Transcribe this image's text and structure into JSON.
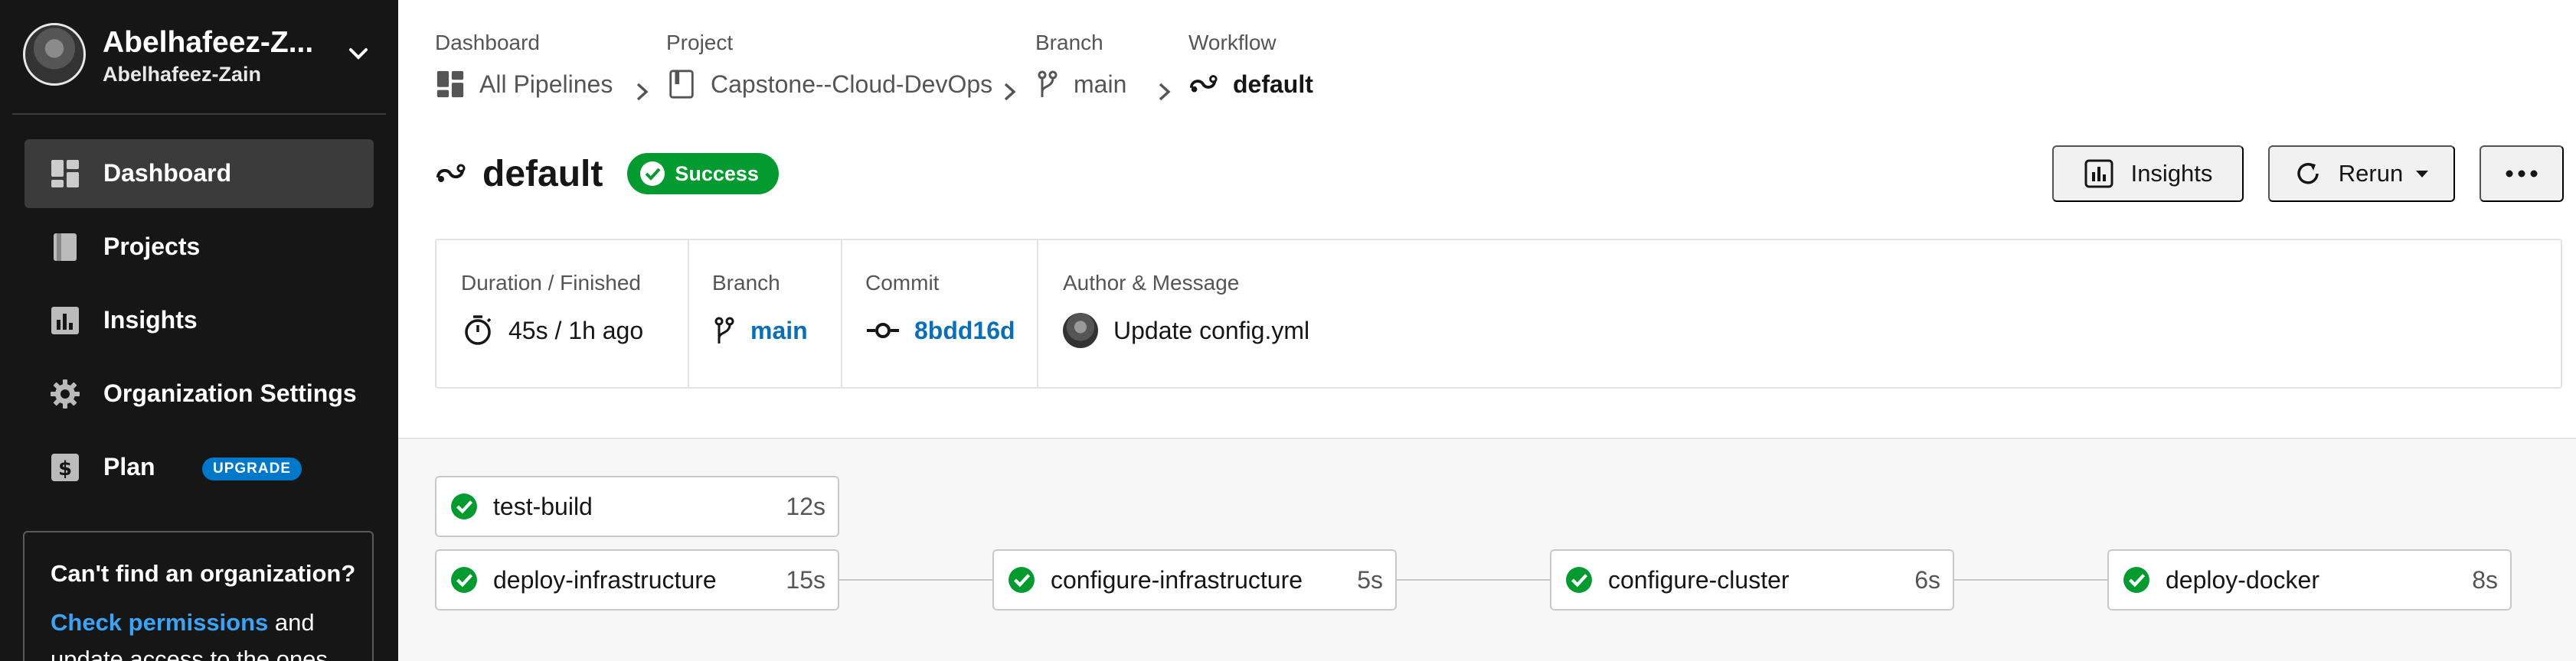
{
  "user": {
    "name": "Abelhafeez-Z...",
    "org": "Abelhafeez-Zain"
  },
  "sidebar": {
    "items": [
      {
        "label": "Dashboard",
        "icon": "dashboard-icon",
        "active": true
      },
      {
        "label": "Projects",
        "icon": "projects-icon"
      },
      {
        "label": "Insights",
        "icon": "insights-icon"
      },
      {
        "label": "Organization Settings",
        "icon": "gear-icon"
      },
      {
        "label": "Plan",
        "icon": "dollar-icon",
        "badge": "UPGRADE"
      }
    ],
    "org_card": {
      "title": "Can't find an organization?",
      "link": "Check permissions",
      "text_after_link": " and",
      "text_cut": "update access to the ones"
    }
  },
  "breadcrumb": [
    {
      "caption": "Dashboard",
      "value": "All Pipelines"
    },
    {
      "caption": "Project",
      "value": "Capstone--Cloud-DevOps"
    },
    {
      "caption": "Branch",
      "value": "main"
    },
    {
      "caption": "Workflow",
      "value": "default"
    }
  ],
  "header": {
    "title": "default",
    "status": "Success",
    "insights_label": "Insights",
    "rerun_label": "Rerun"
  },
  "info": {
    "duration": {
      "caption": "Duration / Finished",
      "value": "45s / 1h ago"
    },
    "branch": {
      "caption": "Branch",
      "value": "main"
    },
    "commit": {
      "caption": "Commit",
      "value": "8bdd16d"
    },
    "author": {
      "caption": "Author & Message",
      "value": "Update config.yml"
    }
  },
  "jobs": [
    {
      "name": "test-build",
      "duration": "12s",
      "status": "success"
    },
    {
      "name": "deploy-infrastructure",
      "duration": "15s",
      "status": "success"
    },
    {
      "name": "configure-infrastructure",
      "duration": "5s",
      "status": "success"
    },
    {
      "name": "configure-cluster",
      "duration": "6s",
      "status": "success"
    },
    {
      "name": "deploy-docker",
      "duration": "8s",
      "status": "success"
    }
  ],
  "colors": {
    "sidebar": "#161616",
    "success": "#039b30",
    "link": "#0b6fb8",
    "upgrade": "#0078ca"
  }
}
